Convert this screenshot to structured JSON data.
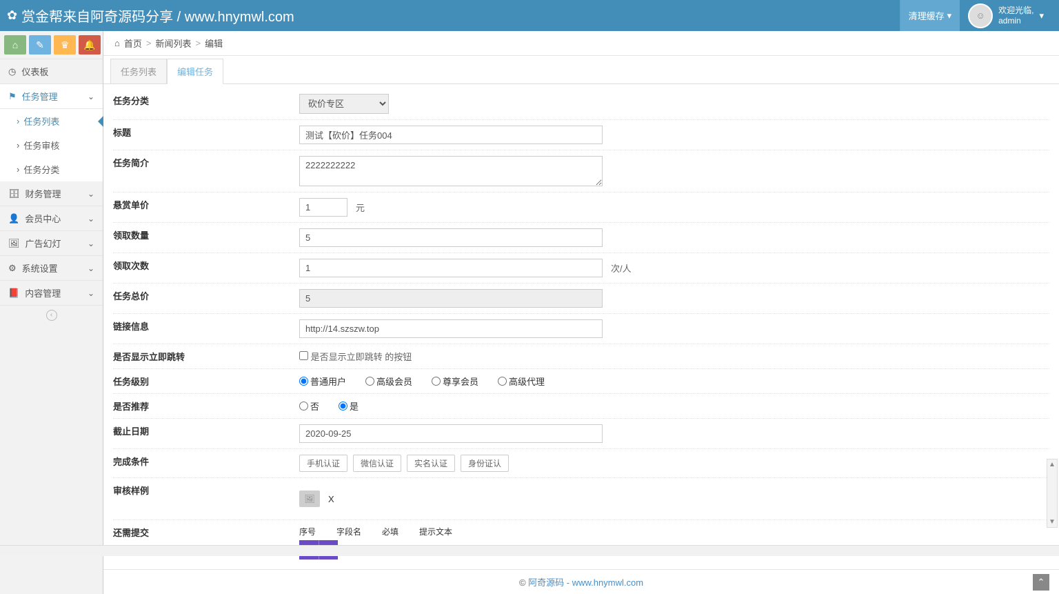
{
  "navbar": {
    "brand": "赏金帮来自阿奇源码分享 / www.hnymwl.com",
    "cache_btn": "清理缓存",
    "welcome": "欢迎光临,",
    "username": "admin"
  },
  "breadcrumb": {
    "home": "首页",
    "list": "新闻列表",
    "current": "编辑"
  },
  "tabs": {
    "list": "任务列表",
    "edit": "编辑任务"
  },
  "sidebar": {
    "dashboard": "仪表板",
    "tasks": "任务管理",
    "tasks_sub": {
      "list": "任务列表",
      "audit": "任务审核",
      "cat": "任务分类"
    },
    "finance": "财务管理",
    "member": "会员中心",
    "ads": "广告幻灯",
    "system": "系统设置",
    "content": "内容管理"
  },
  "form": {
    "category_label": "任务分类",
    "category_value": "砍价专区",
    "title_label": "标题",
    "title_value": "测试【砍价】任务004",
    "intro_label": "任务简介",
    "intro_value": "2222222222",
    "price_label": "悬赏单价",
    "price_value": "1",
    "price_suffix": "元",
    "qty_label": "领取数量",
    "qty_value": "5",
    "times_label": "领取次数",
    "times_value": "1",
    "times_suffix": "次/人",
    "total_label": "任务总价",
    "total_value": "5",
    "link_label": "链接信息",
    "link_value": "http://14.szszw.top",
    "jump_label": "是否显示立即跳转",
    "jump_cb_text": "是否显示立即跳转 的按钮",
    "level_label": "任务级别",
    "level_opts": {
      "a": "普通用户",
      "b": "高级会员",
      "c": "尊享会员",
      "d": "高级代理"
    },
    "recommend_label": "是否推荐",
    "opt_no": "否",
    "opt_yes": "是",
    "deadline_label": "截止日期",
    "deadline_value": "2020-09-25",
    "cond_label": "完成条件",
    "cond_opts": {
      "a": "手机认证",
      "b": "微信认证",
      "c": "实名认证",
      "d": "身份证认"
    },
    "sample_label": "审核样例",
    "sample_x": "X",
    "extra_label": "还需提交",
    "extra_head": {
      "no": "序号",
      "name": "字段名",
      "req": "必填",
      "hint": "提示文本"
    },
    "plus": "+",
    "minus": "-"
  },
  "footer": {
    "copy": "© ",
    "link": "阿奇源码 - www.hnymwl.com"
  }
}
